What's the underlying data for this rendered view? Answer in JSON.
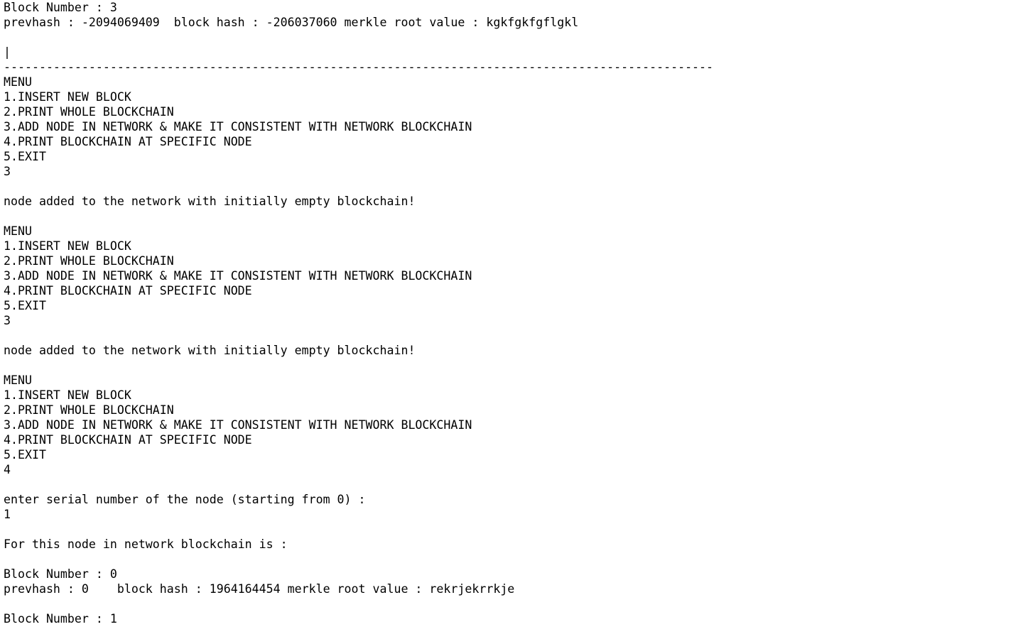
{
  "terminal": {
    "lines": [
      "Block Number : 3",
      "prevhash : -2094069409  block hash : -206037060 merkle root value : kgkfgkfgflgkl",
      "",
      "|",
      "----------------------------------------------------------------------------------------------------",
      "MENU",
      "1.INSERT NEW BLOCK",
      "2.PRINT WHOLE BLOCKCHAIN",
      "3.ADD NODE IN NETWORK & MAKE IT CONSISTENT WITH NETWORK BLOCKCHAIN",
      "4.PRINT BLOCKCHAIN AT SPECIFIC NODE",
      "5.EXIT",
      "3",
      "",
      "node added to the network with initially empty blockchain!",
      "",
      "MENU",
      "1.INSERT NEW BLOCK",
      "2.PRINT WHOLE BLOCKCHAIN",
      "3.ADD NODE IN NETWORK & MAKE IT CONSISTENT WITH NETWORK BLOCKCHAIN",
      "4.PRINT BLOCKCHAIN AT SPECIFIC NODE",
      "5.EXIT",
      "3",
      "",
      "node added to the network with initially empty blockchain!",
      "",
      "MENU",
      "1.INSERT NEW BLOCK",
      "2.PRINT WHOLE BLOCKCHAIN",
      "3.ADD NODE IN NETWORK & MAKE IT CONSISTENT WITH NETWORK BLOCKCHAIN",
      "4.PRINT BLOCKCHAIN AT SPECIFIC NODE",
      "5.EXIT",
      "4",
      "",
      "enter serial number of the node (starting from 0) :",
      "1",
      "",
      "For this node in network blockchain is :",
      "",
      "Block Number : 0",
      "prevhash : 0    block hash : 1964164454 merkle root value : rekrjekrrkje",
      "",
      "Block Number : 1"
    ]
  }
}
